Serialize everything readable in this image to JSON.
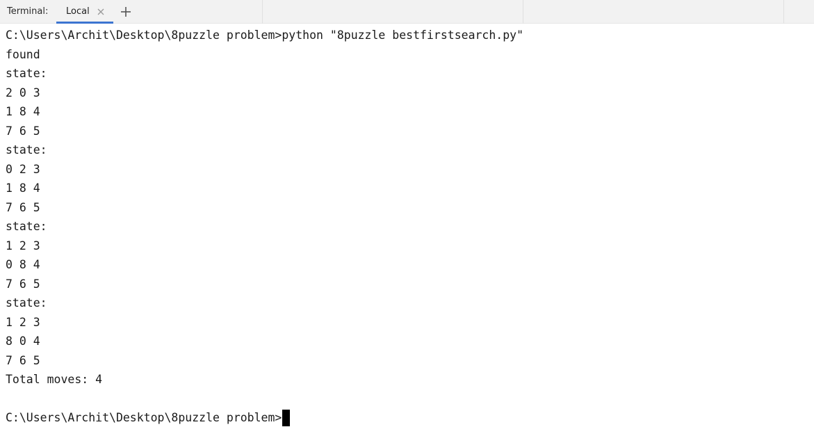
{
  "tabbar": {
    "label": "Terminal:",
    "tabs": [
      {
        "label": "Local",
        "active": true
      }
    ],
    "close_icon": "close-icon",
    "add_icon": "plus-icon"
  },
  "terminal": {
    "lines": [
      "C:\\Users\\Archit\\Desktop\\8puzzle problem>python \"8puzzle bestfirstsearch.py\"",
      "found",
      "state:",
      "2 0 3",
      "1 8 4",
      "7 6 5",
      "state:",
      "0 2 3",
      "1 8 4",
      "7 6 5",
      "state:",
      "1 2 3",
      "0 8 4",
      "7 6 5",
      "state:",
      "1 2 3",
      "8 0 4",
      "7 6 5",
      "Total moves: 4",
      ""
    ],
    "prompt": "C:\\Users\\Archit\\Desktop\\8puzzle problem>"
  },
  "colors": {
    "accent": "#3c74d1",
    "text": "#1a1a1a",
    "background": "#ffffff",
    "tabbar_bg": "#f2f2f2"
  }
}
